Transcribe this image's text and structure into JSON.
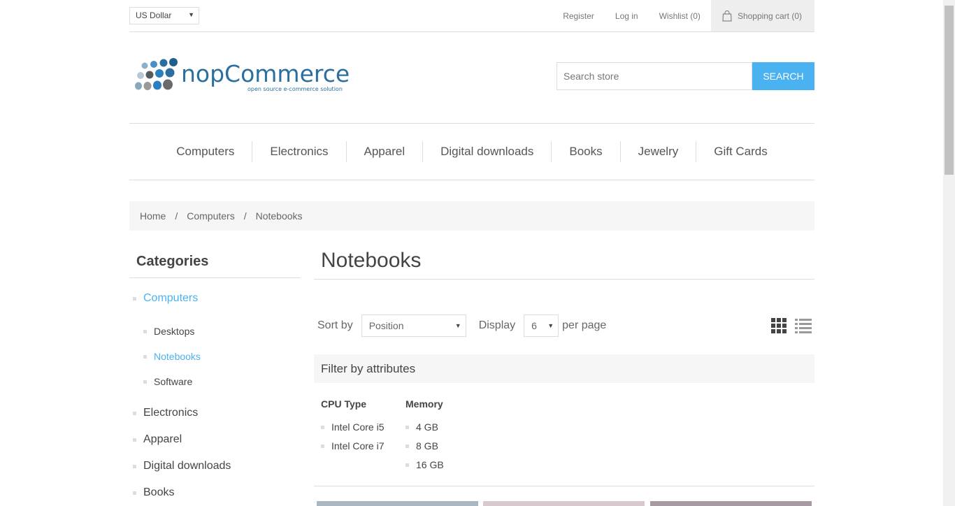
{
  "header": {
    "currency": "US Dollar",
    "links": {
      "register": "Register",
      "login": "Log in",
      "wishlist": "Wishlist (0)",
      "cart": "Shopping cart (0)"
    }
  },
  "logo": {
    "text": "nopCommerce",
    "tagline": "open source e-commerce solution"
  },
  "search": {
    "placeholder": "Search store",
    "button": "SEARCH"
  },
  "top_menu": [
    "Computers",
    "Electronics",
    "Apparel",
    "Digital downloads",
    "Books",
    "Jewelry",
    "Gift Cards"
  ],
  "breadcrumb": {
    "home": "Home",
    "separator": "/",
    "level1": "Computers",
    "current": "Notebooks"
  },
  "sidebar": {
    "title": "Categories",
    "computers": "Computers",
    "sub": [
      "Desktops",
      "Notebooks",
      "Software"
    ],
    "others": [
      "Electronics",
      "Apparel",
      "Digital downloads",
      "Books"
    ]
  },
  "main": {
    "title": "Notebooks",
    "sort_label": "Sort by",
    "sort_value": "Position",
    "display_label": "Display",
    "display_value": "6",
    "per_page": "per page",
    "filter_title": "Filter by attributes",
    "filters": {
      "cpu_head": "CPU Type",
      "cpu": [
        "Intel Core i5",
        "Intel Core i7"
      ],
      "memory_head": "Memory",
      "memory": [
        "4 GB",
        "8 GB",
        "16 GB"
      ]
    }
  },
  "colors": {
    "accent": "#4ab2f1",
    "logo_blue": "#2a6fa0"
  }
}
